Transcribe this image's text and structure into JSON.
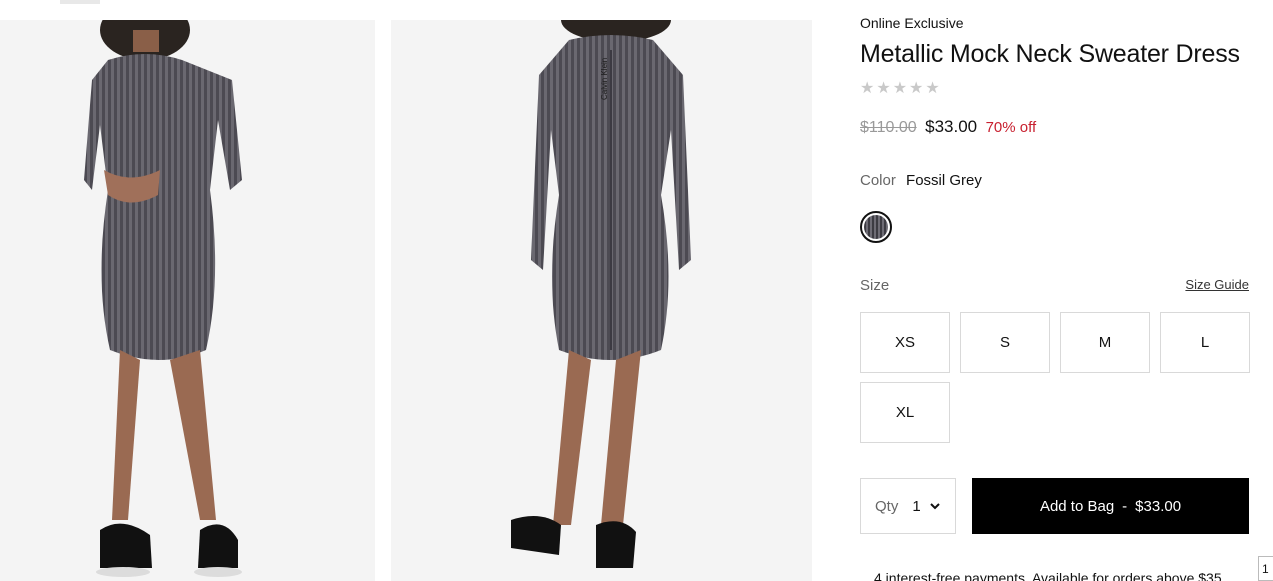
{
  "product": {
    "eyebrow": "Online Exclusive",
    "title": "Metallic Mock Neck Sweater Dress",
    "rating": {
      "stars": "★★★★★",
      "value": 0,
      "max": 5
    },
    "price": {
      "original": "$110.00",
      "current": "$33.00",
      "discount": "70% off"
    },
    "color": {
      "label": "Color",
      "value": "Fossil Grey",
      "swatch_hex": "#55535b"
    },
    "size": {
      "label": "Size",
      "guide_link": "Size Guide",
      "options": [
        "XS",
        "S",
        "M",
        "L",
        "XL"
      ]
    },
    "qty": {
      "label": "Qty",
      "value": "1"
    },
    "add_to_bag": {
      "label": "Add to Bag",
      "separator": "-",
      "price": "$33.00"
    },
    "payments_text": "4 interest-free payments. Available for orders above $35",
    "corner_tab": "1"
  },
  "images": {
    "front": "model-front-photo",
    "back": "model-back-photo",
    "back_print": "Calvin Klein",
    "dress_hex": "#5d5b62",
    "shoe_hex": "#111111"
  }
}
